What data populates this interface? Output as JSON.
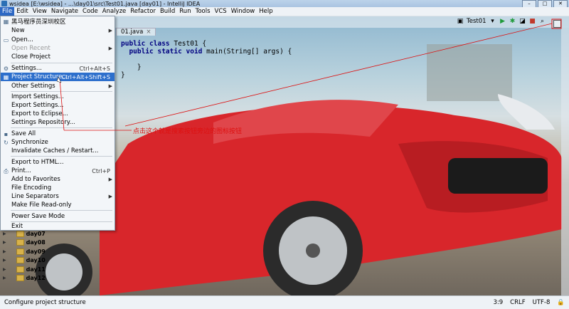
{
  "titlebar": {
    "title": "wsidea [E:\\wsidea] - ...\\day01\\src\\Test01.java [day01] - IntelliJ IDEA"
  },
  "window_buttons": [
    "–",
    "□",
    "✕"
  ],
  "menubar": [
    "File",
    "Edit",
    "View",
    "Navigate",
    "Code",
    "Analyze",
    "Refactor",
    "Build",
    "Run",
    "Tools",
    "VCS",
    "Window",
    "Help"
  ],
  "toolbar": {
    "run_config": "Test01"
  },
  "editor": {
    "tab": "01.java",
    "code": {
      "line1_kw": "public class",
      "line1_rest": " Test01 {",
      "line2_kw": "public static void",
      "line2_rest": " main(String[] args) {",
      "line3": "}",
      "line4": "}"
    }
  },
  "file_menu": {
    "org": "黑马程序员深圳校区",
    "items": [
      {
        "label": "New",
        "shortcut": "",
        "submenu": true
      },
      {
        "label": "Open...",
        "shortcut": "",
        "submenu": false
      },
      {
        "label": "Open Recent",
        "shortcut": "",
        "submenu": true,
        "disabled": true
      },
      {
        "label": "Close Project",
        "shortcut": "",
        "submenu": false
      },
      {
        "label": "Settings...",
        "shortcut": "Ctrl+Alt+S",
        "submenu": false
      },
      {
        "label": "Project Structure...",
        "shortcut": "Ctrl+Alt+Shift+S",
        "submenu": false,
        "highlighted": true
      },
      {
        "label": "Other Settings",
        "shortcut": "",
        "submenu": true
      },
      {
        "label": "Import Settings...",
        "shortcut": "",
        "submenu": false
      },
      {
        "label": "Export Settings...",
        "shortcut": "",
        "submenu": false
      },
      {
        "label": "Export to Eclipse...",
        "shortcut": "",
        "submenu": false
      },
      {
        "label": "Settings Repository...",
        "shortcut": "",
        "submenu": false
      },
      {
        "label": "Save All",
        "shortcut": "",
        "submenu": false
      },
      {
        "label": "Synchronize",
        "shortcut": "",
        "submenu": false
      },
      {
        "label": "Invalidate Caches / Restart...",
        "shortcut": "",
        "submenu": false
      },
      {
        "label": "Export to HTML...",
        "shortcut": "",
        "submenu": false
      },
      {
        "label": "Print...",
        "shortcut": "Ctrl+P",
        "submenu": false
      },
      {
        "label": "Add to Favorites",
        "shortcut": "",
        "submenu": true
      },
      {
        "label": "File Encoding",
        "shortcut": "",
        "submenu": false
      },
      {
        "label": "Line Separators",
        "shortcut": "",
        "submenu": true
      },
      {
        "label": "Make File Read-only",
        "shortcut": "",
        "submenu": false
      },
      {
        "label": "Power Save Mode",
        "shortcut": "",
        "submenu": false
      },
      {
        "label": "Exit",
        "shortcut": "",
        "submenu": false
      }
    ]
  },
  "annotation": "点击这个就是搜索按钮旁边的图标按钮",
  "project_tree": [
    "day07",
    "day08",
    "day09",
    "day10",
    "day11",
    "day12"
  ],
  "statusbar": {
    "message": "Configure project structure",
    "position": "3:9",
    "line_sep": "CRLF",
    "encoding": "UTF-8"
  },
  "colors": {
    "menu_highlight": "#2d6fcc",
    "annotation": "#dd1111"
  }
}
